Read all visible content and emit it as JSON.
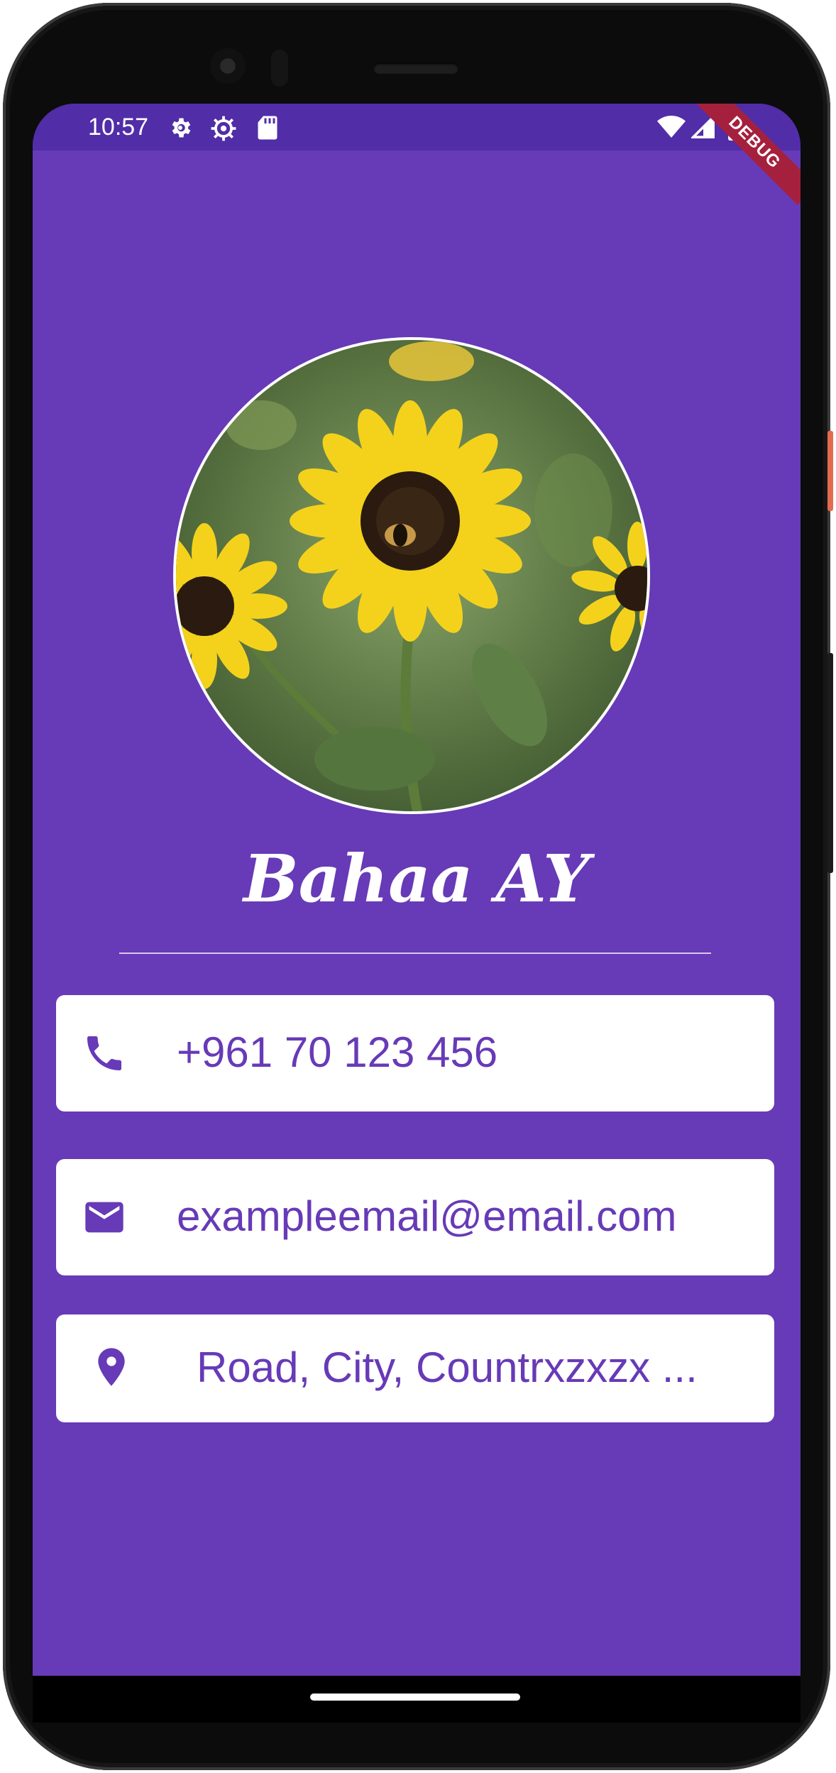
{
  "status_bar": {
    "time": "10:57",
    "left_icons": [
      "settings-gear-icon",
      "settings-gear-alt-icon",
      "sd-card-icon"
    ],
    "right_icons": [
      "wifi-icon",
      "signal-icon",
      "battery-icon"
    ]
  },
  "debug_banner": "DEBUG",
  "profile": {
    "avatar_image": "sunflower-with-bee-photo",
    "name": "Bahaa AY"
  },
  "contacts": {
    "phone": {
      "icon": "phone-icon",
      "value": "+961 70 123 456"
    },
    "email": {
      "icon": "mail-icon",
      "value": "exampleemail@email.com"
    },
    "address": {
      "icon": "location-pin-icon",
      "value": "Road, City, Countrxzxzx ..."
    }
  },
  "colors": {
    "background": "#673ab7",
    "status_bar": "#512da8",
    "card": "#ffffff",
    "accent_text": "#673ab7"
  }
}
